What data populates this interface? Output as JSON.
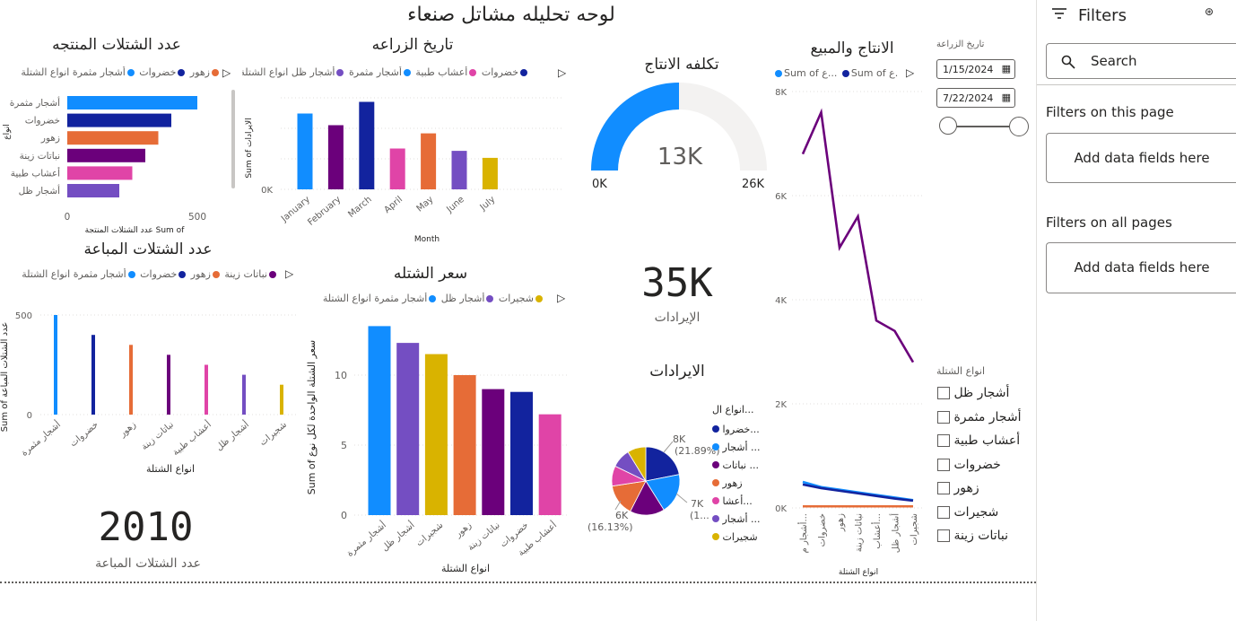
{
  "report_title": "لوحه تحليله مشاتل صنعاء",
  "colors": {
    "fruit_trees": "#118dff",
    "vegetables": "#12239e",
    "flowers": "#e66c37",
    "ornamental": "#6b007b",
    "herbs": "#e044a7",
    "shade_trees": "#744ec2",
    "shrubs": "#d9b300"
  },
  "produced_chart": {
    "title": "عدد الشتلات المنتجه",
    "legend": [
      "زهور",
      "خضروات",
      "أشجار مثمرة",
      "انواع الشتلة"
    ],
    "xlabel": "عدد الشتلات المنتجة Sum of",
    "ylabel": "انواع",
    "ticks": [
      "0",
      "500"
    ]
  },
  "planting_chart": {
    "title": "تاريخ الزراعه",
    "legend": [
      "خضروات",
      "أعشاب طبية",
      "أشجار مثمرة",
      "أشجار ظل",
      "انواع الشتلة"
    ],
    "xlabel": "Month",
    "ylabel": "Sum of الايرادات",
    "ticks": [
      "0K"
    ]
  },
  "gauge": {
    "title": "تكلفه الانتاج",
    "value": "13K",
    "min": "0K",
    "max": "26K",
    "fraction": 0.5
  },
  "kpi_revenue": {
    "value": "35K",
    "label": "الإيرادات"
  },
  "kpi_sold": {
    "value": "2010",
    "label": "عدد الشتلات المباعة"
  },
  "sold_chart": {
    "title": "عدد الشتلات المباعة",
    "legend": [
      "نباتات زينة",
      "زهور",
      "خضروات",
      "أشجار مثمرة",
      "انواع الشتلة"
    ],
    "xlabel": "انواع الشتلة",
    "ylabel": "Sum of عدد الشتلات المباعة",
    "ticks": [
      "0",
      "500"
    ]
  },
  "price_chart": {
    "title": "سعر الشتله",
    "legend": [
      "شجيرات",
      "أشجار ظل",
      "أشجار مثمرة",
      "انواع الشتلة"
    ],
    "xlabel": "انواع الشتلة",
    "ylabel": "Sum of سعر الشتلة الواحدة لكل نوع",
    "ticks": [
      "0",
      "5",
      "10"
    ]
  },
  "pie_section": {
    "title": "الايرادات",
    "legend_title": "انواع ال...",
    "legend": [
      "خضروا...",
      "أشجار ...",
      "نباتات ...",
      "زهور",
      "أعشا...",
      "أشجار ...",
      "شجيرات"
    ],
    "label_top": "8K",
    "label_top_pct": "(21.89%)",
    "label_right": "7K",
    "label_right_pct": "(1...",
    "label_left": "6K",
    "label_left_pct": "(16.13%)"
  },
  "line_chart": {
    "title": "الانتاج والمبيع",
    "legend": [
      "Sum of ع...",
      "Sum of ع..."
    ],
    "xlabel": "انواع الشتلة",
    "ticks": [
      "8K",
      "6K",
      "4K",
      "2K",
      "0K"
    ]
  },
  "date_slicer": {
    "label": "تاريخ الزراعة",
    "start": "1/15/2024",
    "end": "7/22/2024"
  },
  "type_slicer": {
    "title": "انواع الشتلة",
    "items": [
      "أشجار ظل",
      "أشجار مثمرة",
      "أعشاب طبية",
      "خضروات",
      "زهور",
      "شجيرات",
      "نباتات زينة"
    ]
  },
  "filters": {
    "title": "Filters",
    "search_placeholder": "Search",
    "this_page": "Filters on this page",
    "all_pages": "Filters on all pages",
    "add_fields": "Add data fields here"
  },
  "chart_data": [
    {
      "type": "bar",
      "title": "عدد الشتلات المنتجه",
      "orientation": "horizontal",
      "categories": [
        "أشجار مثمرة",
        "خضروات",
        "زهور",
        "نباتات زينة",
        "أعشاب طبية",
        "أشجار ظل"
      ],
      "values": [
        500,
        400,
        350,
        300,
        250,
        200
      ],
      "colors": [
        "#118dff",
        "#12239e",
        "#e66c37",
        "#6b007b",
        "#e044a7",
        "#744ec2"
      ],
      "xlim": [
        0,
        550
      ]
    },
    {
      "type": "bar",
      "title": "تاريخ الزراعه",
      "categories": [
        "January",
        "February",
        "March",
        "April",
        "May",
        "June",
        "July"
      ],
      "values": [
        6.5,
        5.5,
        7.5,
        3.5,
        4.8,
        3.3,
        2.7
      ],
      "colors": [
        "#118dff",
        "#6b007b",
        "#12239e",
        "#e044a7",
        "#e66c37",
        "#744ec2",
        "#d9b300"
      ],
      "ylim": [
        0,
        8
      ]
    },
    {
      "type": "bar",
      "title": "عدد الشتلات المباعة",
      "categories": [
        "أشجار مثمرة",
        "خضروات",
        "زهور",
        "نباتات زينة",
        "أعشاب طبية",
        "أشجار ظل",
        "شجيرات"
      ],
      "values": [
        500,
        400,
        350,
        300,
        250,
        200,
        150
      ],
      "colors": [
        "#118dff",
        "#12239e",
        "#e66c37",
        "#6b007b",
        "#e044a7",
        "#744ec2",
        "#d9b300"
      ],
      "ylim": [
        0,
        550
      ]
    },
    {
      "type": "bar",
      "title": "سعر الشتله",
      "categories": [
        "أشجار مثمرة",
        "أشجار ظل",
        "شجيرات",
        "زهور",
        "نباتات زينة",
        "خضروات",
        "أعشاب طبية"
      ],
      "values": [
        13.5,
        12.3,
        11.5,
        10,
        9,
        8.8,
        7.2
      ],
      "colors": [
        "#118dff",
        "#744ec2",
        "#d9b300",
        "#e66c37",
        "#6b007b",
        "#12239e",
        "#e044a7"
      ],
      "ylim": [
        0,
        14
      ]
    },
    {
      "type": "pie",
      "title": "الايرادات",
      "labels": [
        "خضروات",
        "أشجار مثمرة",
        "نباتات زينة",
        "زهور",
        "أعشاب طبية",
        "أشجار ظل",
        "شجيرات"
      ],
      "values": [
        8,
        7,
        6,
        5.5,
        3.5,
        3.3,
        3.2
      ],
      "colors": [
        "#12239e",
        "#118dff",
        "#6b007b",
        "#e66c37",
        "#e044a7",
        "#744ec2",
        "#d9b300"
      ]
    },
    {
      "type": "line",
      "title": "الانتاج والمبيع",
      "categories": [
        "أشجار م...",
        "خضروات",
        "زهور",
        "نباتات زينة",
        "أعشاب...",
        "أشجار ظل",
        "شجيرات"
      ],
      "series": [
        {
          "name": "",
          "values": [
            6.8,
            7.6,
            5,
            5.6,
            3.6,
            3.4,
            2.8
          ],
          "color": "#6b007b"
        },
        {
          "name": "",
          "values": [
            0.5,
            0.4,
            0.35,
            0.3,
            0.25,
            0.2,
            0.15
          ],
          "color": "#118dff"
        },
        {
          "name": "",
          "values": [
            0.45,
            0.38,
            0.33,
            0.28,
            0.23,
            0.18,
            0.14
          ],
          "color": "#12239e"
        },
        {
          "name": "",
          "values": [
            0.03,
            0.03,
            0.03,
            0.03,
            0.03,
            0.03,
            0.03
          ],
          "color": "#e66c37"
        }
      ],
      "ylim": [
        0,
        8
      ]
    }
  ]
}
